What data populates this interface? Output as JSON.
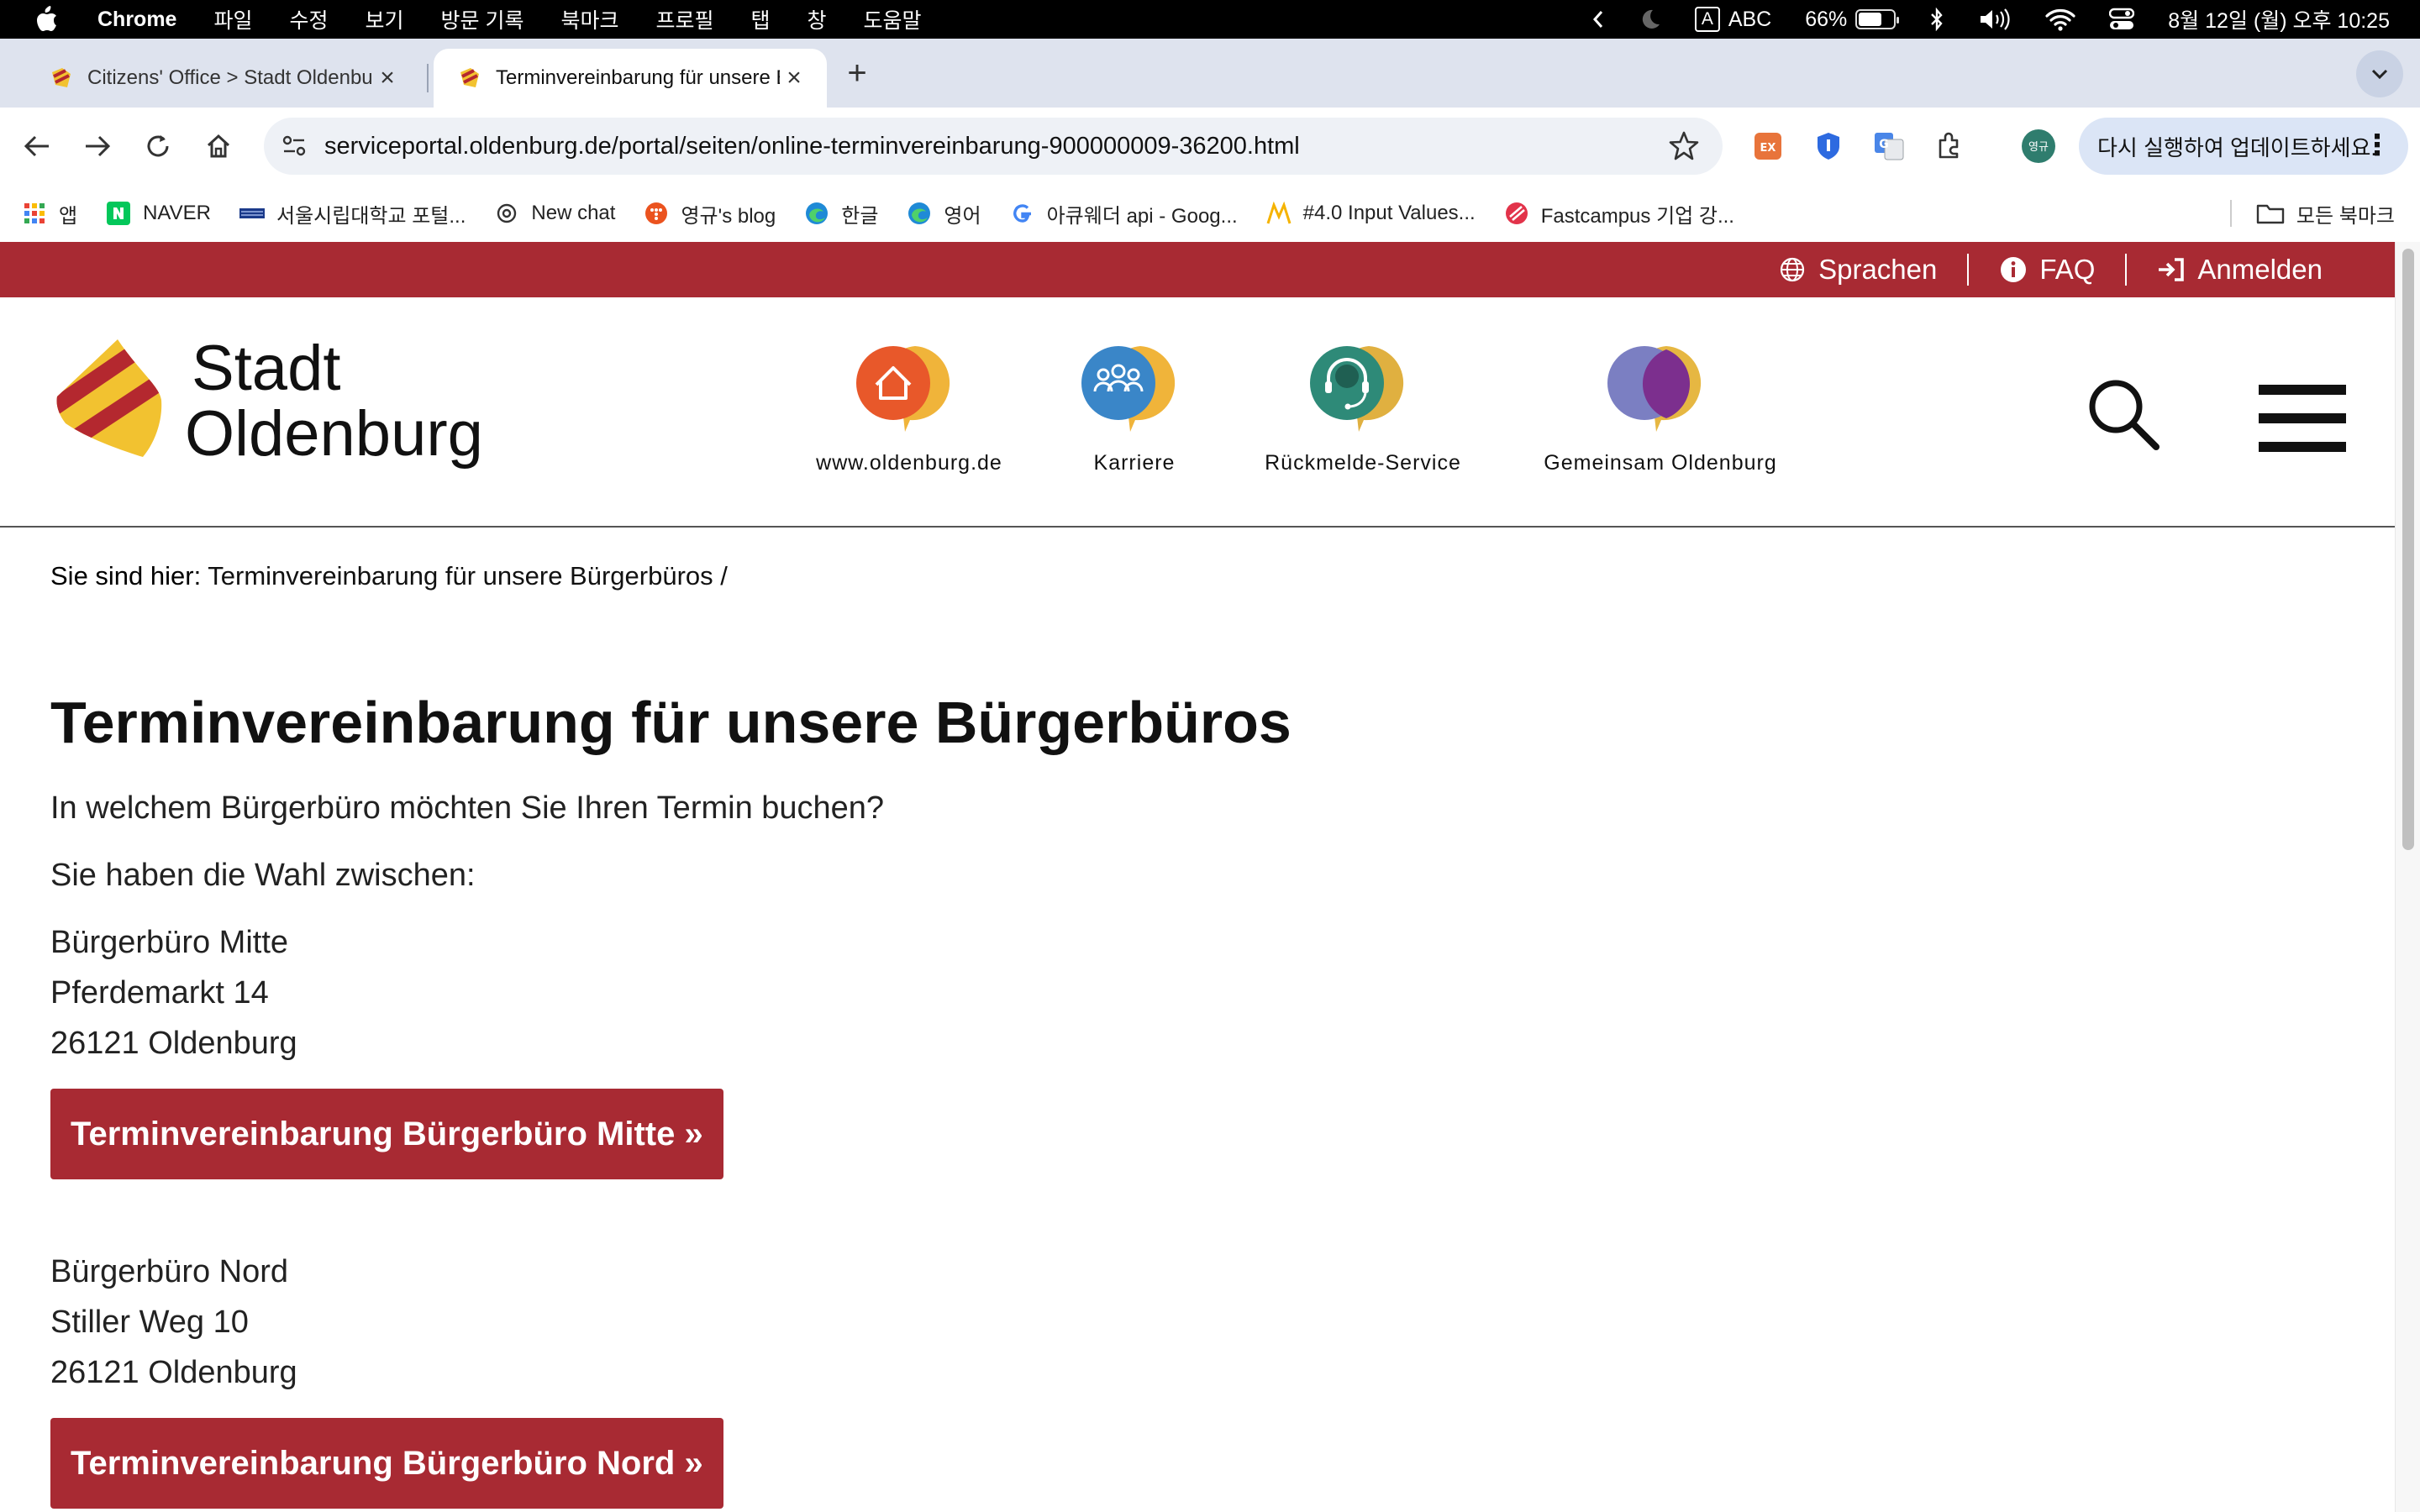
{
  "menubar": {
    "app": "Chrome",
    "items": [
      "파일",
      "수정",
      "보기",
      "방문 기록",
      "북마크",
      "프로필",
      "탭",
      "창",
      "도움말"
    ],
    "status": {
      "input_letter": "A",
      "input_source": "ABC",
      "battery": "66%",
      "battery_level": 0.66,
      "datetime": "8월 12일 (월) 오후 10:25"
    }
  },
  "tabs": [
    {
      "title": "Citizens' Office > Stadt Oldenburg",
      "active": false
    },
    {
      "title": "Terminvereinbarung für unsere Bürgerbüros",
      "active": true
    }
  ],
  "toolbar": {
    "url": "serviceportal.oldenburg.de/portal/seiten/online-terminvereinbarung-900000009-36200.html",
    "ext_ex_label": "EX",
    "profile_initials": "영규",
    "update_label": "다시 실행하여 업데이트하세요."
  },
  "bookmarks": {
    "items": [
      {
        "label": "앱",
        "icon": "apps-grid-icon"
      },
      {
        "label": "NAVER",
        "icon": "naver-icon"
      },
      {
        "label": "서울시립대학교 포털...",
        "icon": "uos-icon"
      },
      {
        "label": "New chat",
        "icon": "openai-icon"
      },
      {
        "label": "영규's blog",
        "icon": "tistory-icon"
      },
      {
        "label": "한글",
        "icon": "edge-icon"
      },
      {
        "label": "영어",
        "icon": "edge-icon"
      },
      {
        "label": "아큐웨더 api - Goog...",
        "icon": "google-icon"
      },
      {
        "label": "#4.0 Input Values...",
        "icon": "nomad-icon"
      },
      {
        "label": "Fastcampus 기업 강...",
        "icon": "fastcampus-icon"
      }
    ],
    "all_label": "모든 북마크"
  },
  "site": {
    "topbar": {
      "languages": "Sprachen",
      "faq": "FAQ",
      "login": "Anmelden"
    },
    "logo": {
      "line1": "Stadt",
      "line2": "Oldenburg"
    },
    "nav": [
      {
        "label": "www.oldenburg.de"
      },
      {
        "label": "Karriere"
      },
      {
        "label": "Rückmelde-Service"
      },
      {
        "label": "Gemeinsam Oldenburg"
      }
    ],
    "breadcrumb": {
      "prefix": "Sie sind hier:",
      "current": "Terminvereinbarung für unsere Bürgerbüros /"
    }
  },
  "main": {
    "title": "Terminvereinbarung für unsere Bürgerbüros",
    "question": "In welchem Bürgerbüro möchten Sie Ihren Termin buchen?",
    "choice": "Sie haben die Wahl zwischen:",
    "offices": [
      {
        "name": "Bürgerbüro Mitte",
        "street": "Pferdemarkt 14",
        "city": "26121 Oldenburg",
        "button": "Terminvereinbarung Bürgerbüro Mitte »"
      },
      {
        "name": "Bürgerbüro Nord",
        "street": "Stiller Weg 10",
        "city": "26121 Oldenburg",
        "button": "Terminvereinbarung Bürgerbüro Nord »"
      }
    ]
  },
  "colors": {
    "brand_red": "#a82a33",
    "crest_yellow": "#f2c230",
    "bubble_yellow": "#f0b43a"
  }
}
